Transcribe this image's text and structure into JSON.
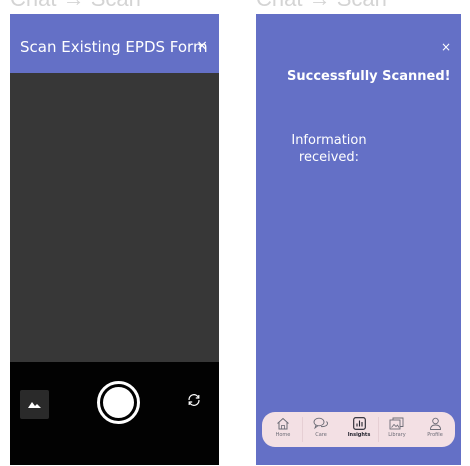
{
  "frames": {
    "left_title": "Chat → Scan",
    "right_title": "Chat → Scan"
  },
  "scan_screen": {
    "title": "Scan Existing EPDS Form",
    "close_label": "×"
  },
  "result_screen": {
    "close_label": "×",
    "title": "Successfully Scanned!",
    "info_label": "Information received:"
  },
  "tabbar": {
    "tabs": [
      {
        "label": "Home",
        "icon": "home-icon",
        "active": false
      },
      {
        "label": "Care",
        "icon": "chat-bubbles-icon",
        "active": false
      },
      {
        "label": "Insights",
        "icon": "bar-chart-icon",
        "active": true
      },
      {
        "label": "Library",
        "icon": "library-icon",
        "active": false
      },
      {
        "label": "Profile",
        "icon": "profile-icon",
        "active": false
      }
    ]
  },
  "colors": {
    "header_purple": "#6470c6",
    "camera_gray": "#373737",
    "camera_bar": "#020202",
    "tabbar_bg": "#f3e0e4"
  }
}
